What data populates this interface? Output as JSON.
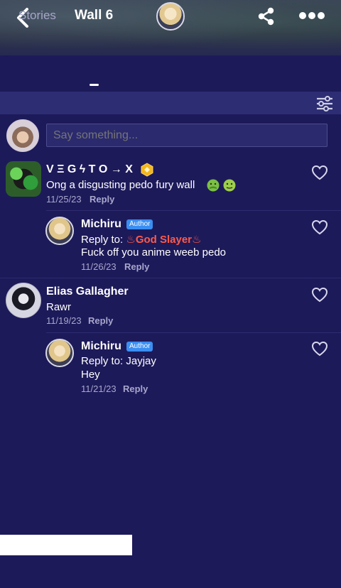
{
  "tabs": [
    {
      "label": "Stories"
    },
    {
      "label": "Wall 6"
    }
  ],
  "composer": {
    "placeholder": "Say something..."
  },
  "comments": [
    {
      "author": "V Ξ G ϟ T O → X",
      "text": "Ong a disgusting pedo fury wall",
      "date": "11/25/23",
      "reply_label": "Reply",
      "replies": [
        {
          "author": "Michiru",
          "badge": "Author",
          "reply_prefix": "Reply to: ",
          "reply_to": "♨God Slayer♨",
          "text": "Fuck off you anime weeb pedo",
          "date": "11/26/23",
          "reply_label": "Reply"
        }
      ]
    },
    {
      "author": "Elias Gallagher",
      "text": "Rawr",
      "date": "11/19/23",
      "reply_label": "Reply",
      "replies": [
        {
          "author": "Michiru",
          "badge": "Author",
          "reply_prefix": "Reply to: ",
          "reply_to": "Jayjay",
          "text": "Hey",
          "date": "11/21/23",
          "reply_label": "Reply"
        }
      ]
    }
  ],
  "colors": {
    "background": "#1d1a5a",
    "filter_bar": "#2d2d74",
    "author_badge": "#3a8ef2",
    "muted_text": "#a8a7cc"
  },
  "icons": {
    "back": "chevron-left-icon",
    "share": "share-icon",
    "more": "more-dots-icon",
    "filter": "sliders-icon",
    "like": "heart-outline-icon",
    "level_badge": "gold-hexagon-badge-icon",
    "emoji_1": "nauseated-face-emoji",
    "emoji_2": "vomiting-face-emoji"
  }
}
